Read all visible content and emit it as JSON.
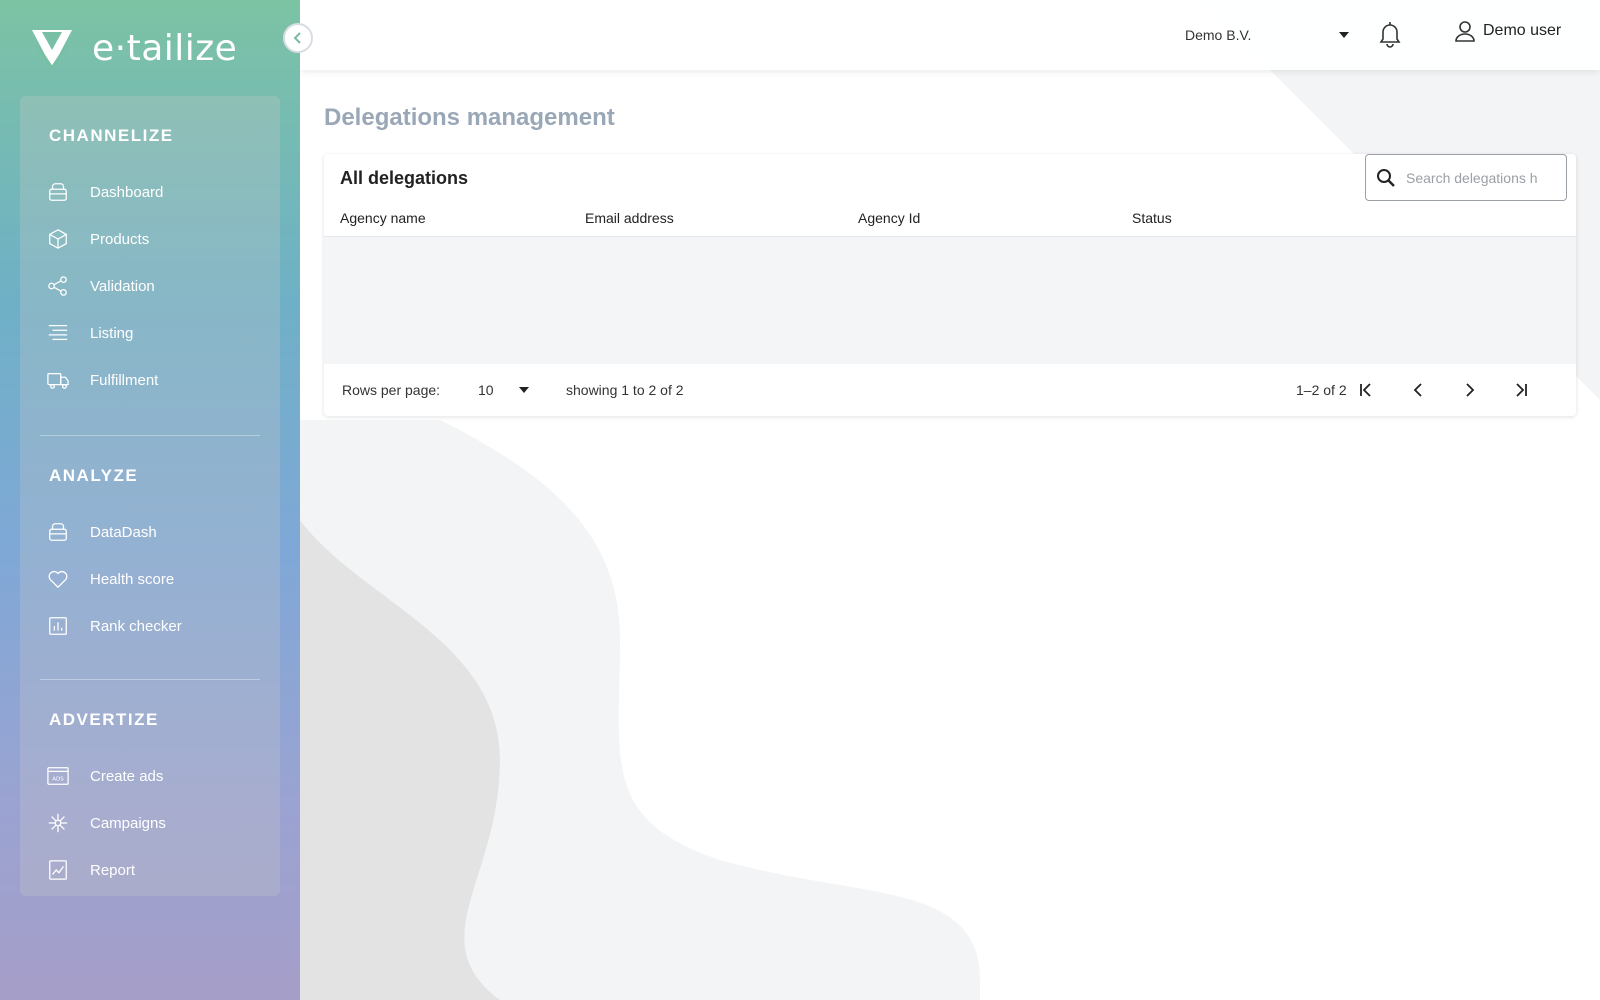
{
  "app": {
    "logo_text": "e·tailize",
    "collapse_icon": "chevron-left-icon"
  },
  "sidebar": {
    "sections": [
      {
        "title": "CHANNELIZE",
        "items": [
          {
            "label": "Dashboard",
            "icon": "basket-icon"
          },
          {
            "label": "Products",
            "icon": "box-icon"
          },
          {
            "label": "Validation",
            "icon": "share-nodes-icon"
          },
          {
            "label": "Listing",
            "icon": "list-icon"
          },
          {
            "label": "Fulfillment",
            "icon": "truck-icon"
          }
        ]
      },
      {
        "title": "ANALYZE",
        "items": [
          {
            "label": "DataDash",
            "icon": "basket-icon"
          },
          {
            "label": "Health score",
            "icon": "heart-icon"
          },
          {
            "label": "Rank checker",
            "icon": "bar-chart-icon"
          }
        ]
      },
      {
        "title": "ADVERTIZE",
        "items": [
          {
            "label": "Create ads",
            "icon": "ads-icon"
          },
          {
            "label": "Campaigns",
            "icon": "network-icon"
          },
          {
            "label": "Report",
            "icon": "report-icon"
          }
        ]
      }
    ]
  },
  "topbar": {
    "company": "Demo B.V.",
    "user_name": "Demo user"
  },
  "page": {
    "title": "Delegations management"
  },
  "table": {
    "title": "All delegations",
    "search_placeholder": "Search delegations h",
    "columns": [
      "Agency name",
      "Email address",
      "Agency Id",
      "Status"
    ],
    "rows": [],
    "rows_per_page_label": "Rows per page:",
    "rows_per_page": "10",
    "showing": "showing 1 to 2 of 2",
    "range": "1–2 of 2"
  },
  "colors": {
    "sidebar_top": "#7cc3a4",
    "sidebar_bottom": "#a59ec8",
    "page_title": "#9aa7b6",
    "table_body": "#f4f5f6"
  }
}
